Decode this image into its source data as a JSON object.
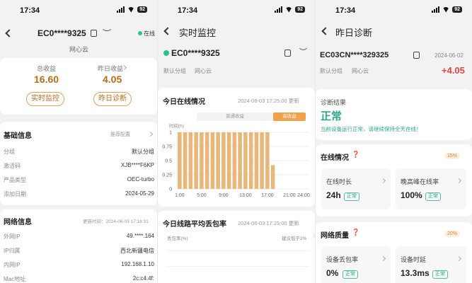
{
  "status_time": "17:34",
  "battery": "92",
  "colors": {
    "accent": "#d9a35a",
    "green": "#2fa58c",
    "red": "#e8453c",
    "bar": "#e8b77a"
  },
  "p1": {
    "device_id": "EC0****9325",
    "online_label": "在线",
    "subtitle": "网心云",
    "total_earnings_label": "总收益",
    "total_earnings_value": "16.60",
    "yesterday_earnings_label": "昨日收益",
    "yesterday_earnings_value": "4.05",
    "btn_monitor": "实时监控",
    "btn_diagnose": "昨日诊断",
    "basic_title": "基础信息",
    "basic_action": "推荐配置",
    "basic_rows": [
      {
        "k": "分组",
        "v": "默认分组"
      },
      {
        "k": "激活码",
        "v": "XJB****F6KP"
      },
      {
        "k": "产品类型",
        "v": "OEC-turbo"
      },
      {
        "k": "添加日期",
        "v": "2024-05-29"
      }
    ],
    "net_title": "网络信息",
    "net_update": "更新时间：2024-06-03 17:16:31",
    "net_rows": [
      {
        "k": "外网IP",
        "v": "49.****.164"
      },
      {
        "k": "IP归属",
        "v": "西北新疆电信"
      },
      {
        "k": "内网IP",
        "v": "192.168.1.10"
      },
      {
        "k": "Mac地址",
        "v": "2c:c4:4f:"
      }
    ]
  },
  "p2": {
    "title": "实时监控",
    "device_id": "EC0****9325",
    "tag1": "默认分组",
    "tag2": "网心云",
    "online_title": "今日在线情况",
    "online_time": "2024-06-03 17:25:00 更新",
    "tab_normal": "普通收益",
    "tab_high": "高收益",
    "yaxis_label": "时间(h)",
    "loss_title": "今日线路平均丢包率",
    "loss_time": "2024-06-03 17:25:00 更新",
    "loss_yaxis_label": "丢包率(%)",
    "loss_hint": "建议低于2%"
  },
  "chart_data": {
    "type": "bar",
    "title": "今日在线情况",
    "ylabel": "时间(h)",
    "ylim": [
      0,
      1
    ],
    "yticks": [
      "1",
      "0.75",
      "0.5",
      "0.25",
      "0"
    ],
    "xticks": [
      "1:00",
      "5:00",
      "9:00",
      "13:00",
      "17:00",
      "21:00",
      "24:00"
    ],
    "categories": [
      "0",
      "1",
      "2",
      "3",
      "4",
      "5",
      "6",
      "7",
      "8",
      "9",
      "10",
      "11",
      "12",
      "13",
      "14",
      "15",
      "16",
      "17"
    ],
    "values": [
      1,
      1,
      1,
      1,
      1,
      1,
      1,
      1,
      1,
      1,
      1,
      1,
      1,
      1,
      1,
      1,
      1,
      0.42
    ]
  },
  "p3": {
    "title": "昨日诊断",
    "device_id": "EC03CN****329325",
    "date": "2024-06-02",
    "earnings": "+4.05",
    "tag1": "默认分组",
    "tag2": "网心云",
    "result_label": "诊断结果",
    "result_value": "正常",
    "result_desc": "当前设备运行正常，请继续保持全天在线！",
    "online_section": "在线情况",
    "online_chip": "15%",
    "online_duration_label": "在线时长",
    "online_duration_value": "24h",
    "online_rate_label": "晚高峰在线率",
    "online_rate_value": "100%",
    "normal": "正常",
    "net_section": "网络质量",
    "net_chip": "20%",
    "loss_label": "设备丢包率",
    "loss_value": "0%",
    "latency_label": "设备时延",
    "latency_value": "13.3ms"
  }
}
